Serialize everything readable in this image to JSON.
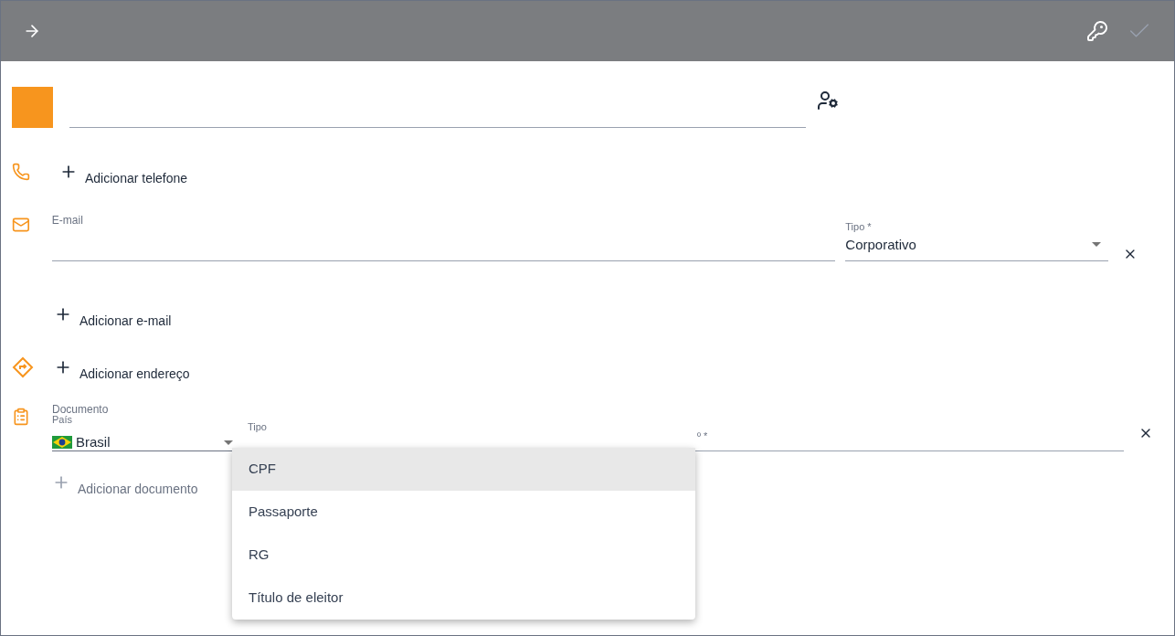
{
  "phones": {
    "add_label": "Adicionar telefone"
  },
  "emails": {
    "label": "E-mail",
    "type": {
      "label": "Tipo *",
      "value": "Corporativo"
    },
    "add_label": "Adicionar e-mail"
  },
  "addresses": {
    "add_label": "Adicionar endereço"
  },
  "document": {
    "section_label": "Documento",
    "country": {
      "label": "País",
      "value": "Brasil"
    },
    "type": {
      "label": "Tipo"
    },
    "number": {
      "label": "º *"
    },
    "add_label": "Adicionar documento",
    "add_disabled": true
  },
  "type_menu": [
    {
      "label": "CPF",
      "selected": true
    },
    {
      "label": "Passaporte",
      "selected": false
    },
    {
      "label": "RG",
      "selected": false
    },
    {
      "label": "Título de eleitor",
      "selected": false
    }
  ]
}
